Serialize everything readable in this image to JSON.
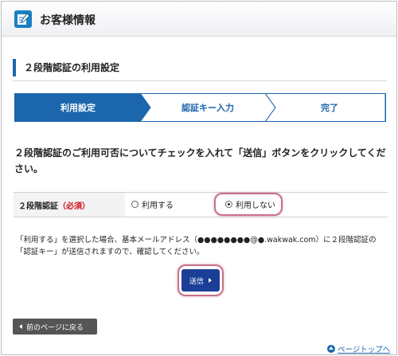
{
  "header": {
    "title": "お客様情報",
    "icon": "edit-document-icon"
  },
  "section": {
    "title": "２段階認証の利用設定"
  },
  "steps": [
    {
      "label": "利用設定",
      "active": true
    },
    {
      "label": "認証キー入力",
      "active": false
    },
    {
      "label": "完了",
      "active": false
    }
  ],
  "instruction": "２段階認証のご利用可否についてチェックを入れて「送信」ボタンをクリックしてください。",
  "form": {
    "label": "２段階認証",
    "required": "（必須）",
    "options": [
      {
        "label": "利用する",
        "checked": false
      },
      {
        "label": "利用しない",
        "checked": true
      }
    ]
  },
  "note": "「利用する」を選択した場合、基本メールアドレス（●●●●●●●●@●.wakwak.com）に２段階認証の「認証キー」が送信されますので、確認してください。",
  "buttons": {
    "submit": "送信",
    "back": "前のページに戻る",
    "pagetop": "ページトップへ"
  },
  "colors": {
    "accent": "#1b66ad",
    "submit": "#1b3f96",
    "required": "#d0121b",
    "highlight": "#c96f8a"
  }
}
